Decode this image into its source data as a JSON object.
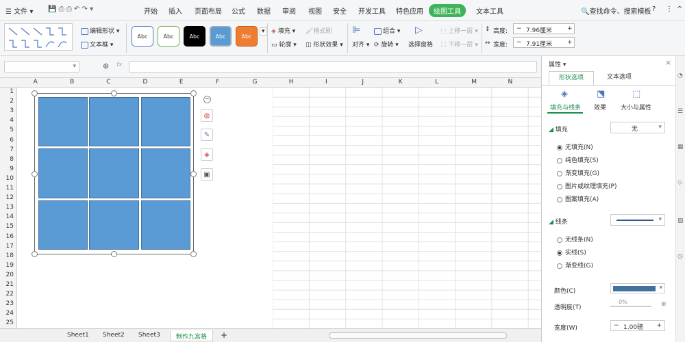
{
  "menu": {
    "file": "文件"
  },
  "tabs": [
    "开始",
    "插入",
    "页面布局",
    "公式",
    "数据",
    "审阅",
    "视图",
    "安全",
    "开发工具",
    "特色应用",
    "绘图工具",
    "文本工具"
  ],
  "active_tab": "绘图工具",
  "search": "查找命令、搜索模板",
  "ribbon": {
    "edit_shape": "编辑形状",
    "text_box": "文本框",
    "styles": [
      "Abc",
      "Abc",
      "Abc",
      "Abc",
      "Abc"
    ],
    "fill": "填充",
    "format_brush": "格式刷",
    "outline": "轮廓",
    "shape_effect": "形状效果",
    "align": "对齐",
    "group": "组合",
    "rotate": "旋转",
    "selection_pane": "选择窗格",
    "bring_forward": "上移一层",
    "send_backward": "下移一层",
    "height_label": "高度:",
    "height_value": "7.96厘米",
    "width_label": "宽度:",
    "width_value": "7.91厘米"
  },
  "formula_bar": {
    "fx": "fx"
  },
  "columns": [
    "A",
    "B",
    "C",
    "D",
    "E",
    "F",
    "G",
    "H",
    "I",
    "J",
    "K",
    "L",
    "M",
    "N"
  ],
  "rows": [
    "1",
    "2",
    "3",
    "4",
    "5",
    "6",
    "7",
    "8",
    "9",
    "10",
    "11",
    "12",
    "13",
    "14",
    "15",
    "16",
    "17",
    "18",
    "19",
    "20",
    "21",
    "22",
    "23",
    "24",
    "25"
  ],
  "sheets": [
    "Sheet1",
    "Sheet2",
    "Sheet3",
    "制作九宫格"
  ],
  "active_sheet": "制作九宫格",
  "panel": {
    "title": "属性",
    "tab_shape": "形状选项",
    "tab_text": "文本选项",
    "sub_fill_line": "填充与线条",
    "sub_effect": "效果",
    "sub_size": "大小与属性",
    "fill_section": "填充",
    "fill_value": "无",
    "fill_options": [
      "无填充(N)",
      "纯色填充(S)",
      "渐变填充(G)",
      "图片或纹理填充(P)",
      "图案填充(A)"
    ],
    "line_section": "线条",
    "line_options": [
      "无线条(N)",
      "实线(S)",
      "渐变线(G)"
    ],
    "color_label": "颜色(C)",
    "transparency_label": "透明度(T)",
    "width_label": "宽度(W)",
    "width_value": "1.00磅",
    "transparency_value": "0%"
  },
  "colors": {
    "accent": "#3fb35a",
    "cell_fill": "#5b9bd5",
    "panel_accent": "#1a8b4a"
  }
}
